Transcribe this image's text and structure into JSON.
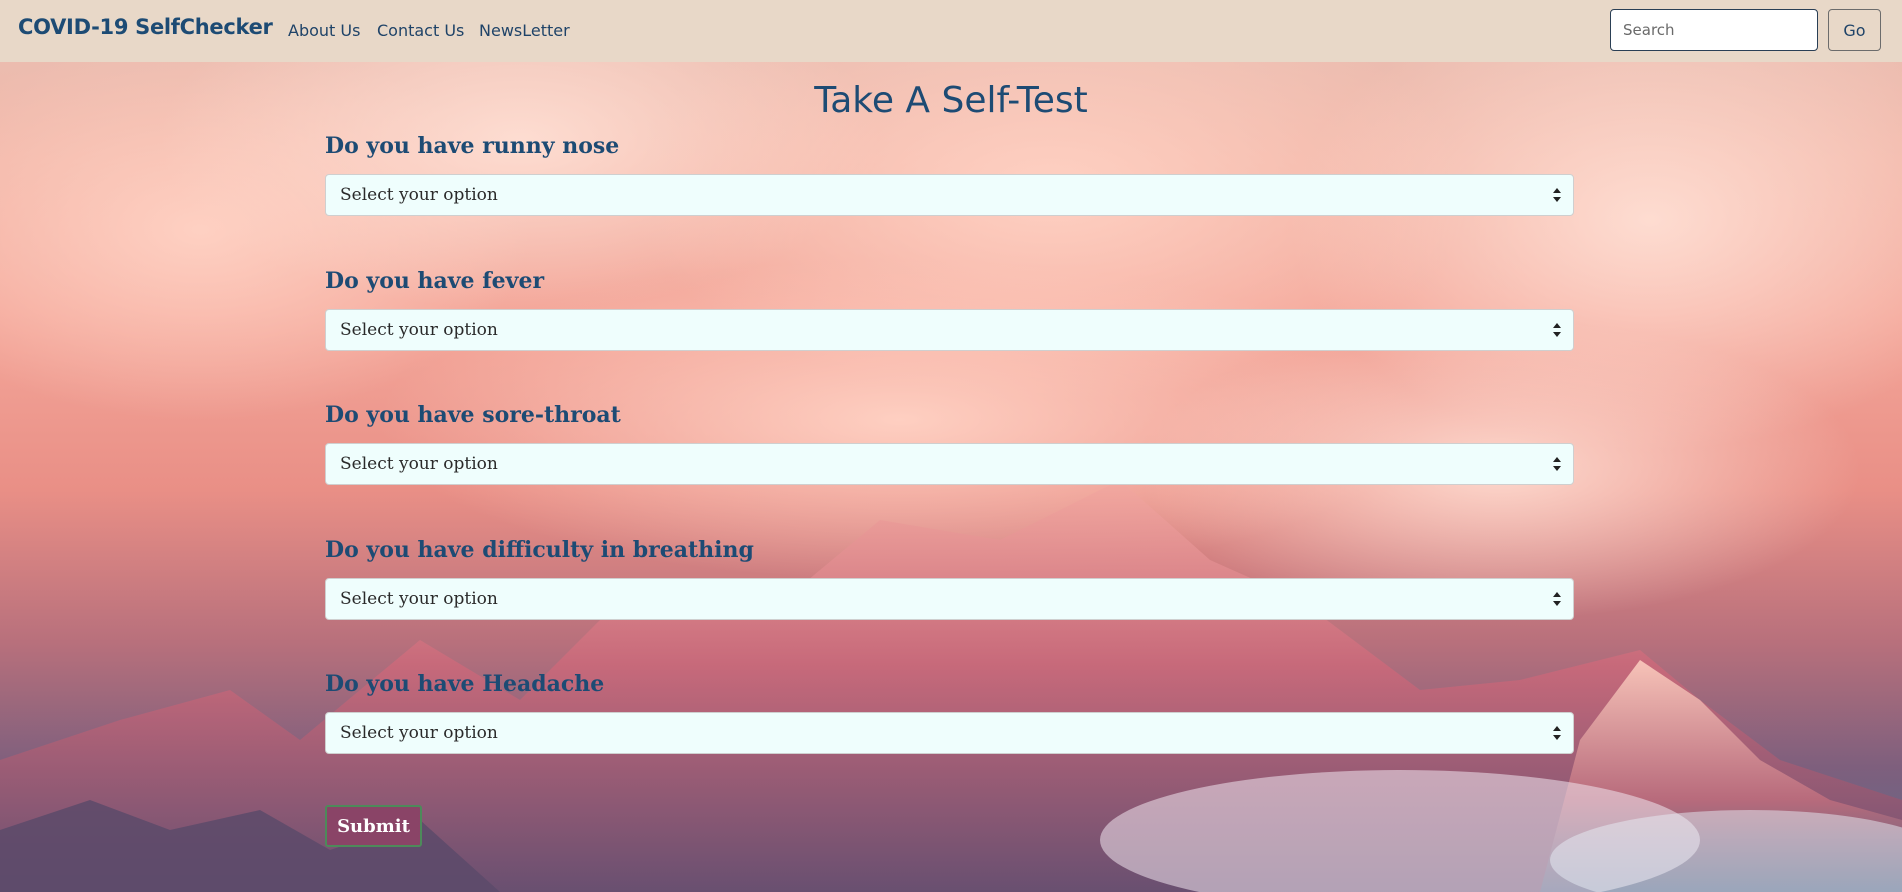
{
  "navbar": {
    "brand": "COVID-19 SelfChecker",
    "links": [
      "About Us",
      "Contact Us",
      "NewsLetter"
    ],
    "search_placeholder": "Search",
    "go_label": "Go"
  },
  "main": {
    "title": "Take A Self-Test",
    "questions": [
      {
        "label": "Do you have runny nose",
        "selected": "Select your option"
      },
      {
        "label": "Do you have fever",
        "selected": "Select your option"
      },
      {
        "label": "Do you have sore-throat",
        "selected": "Select your option"
      },
      {
        "label": "Do you have difficulty in breathing",
        "selected": "Select your option"
      },
      {
        "label": "Do you have Headache",
        "selected": "Select your option"
      }
    ],
    "submit_label": "Submit"
  },
  "colors": {
    "navbar_bg": "#e8d8c8",
    "brand_text": "#1d4b74",
    "select_bg": "#effefd",
    "submit_bg": "#8a4467"
  }
}
